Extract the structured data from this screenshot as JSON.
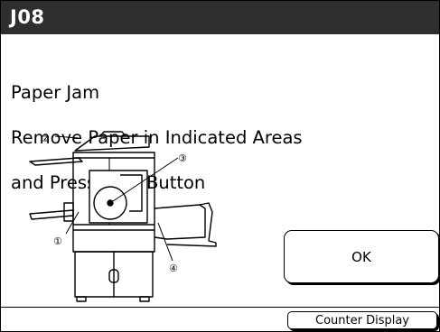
{
  "header": {
    "error_code": "J08"
  },
  "message": {
    "line1": "Paper Jam",
    "line2": "Remove Paper in Indicated Areas",
    "line3": "and Press [OK] Button"
  },
  "diagram": {
    "markers": [
      "①",
      "②",
      "③",
      "④"
    ]
  },
  "buttons": {
    "ok_label": "OK",
    "counter_label": "Counter Display"
  },
  "colors": {
    "titlebar_bg": "#2f2f2f",
    "titlebar_text": "#ffffff",
    "background": "#ffffff"
  }
}
